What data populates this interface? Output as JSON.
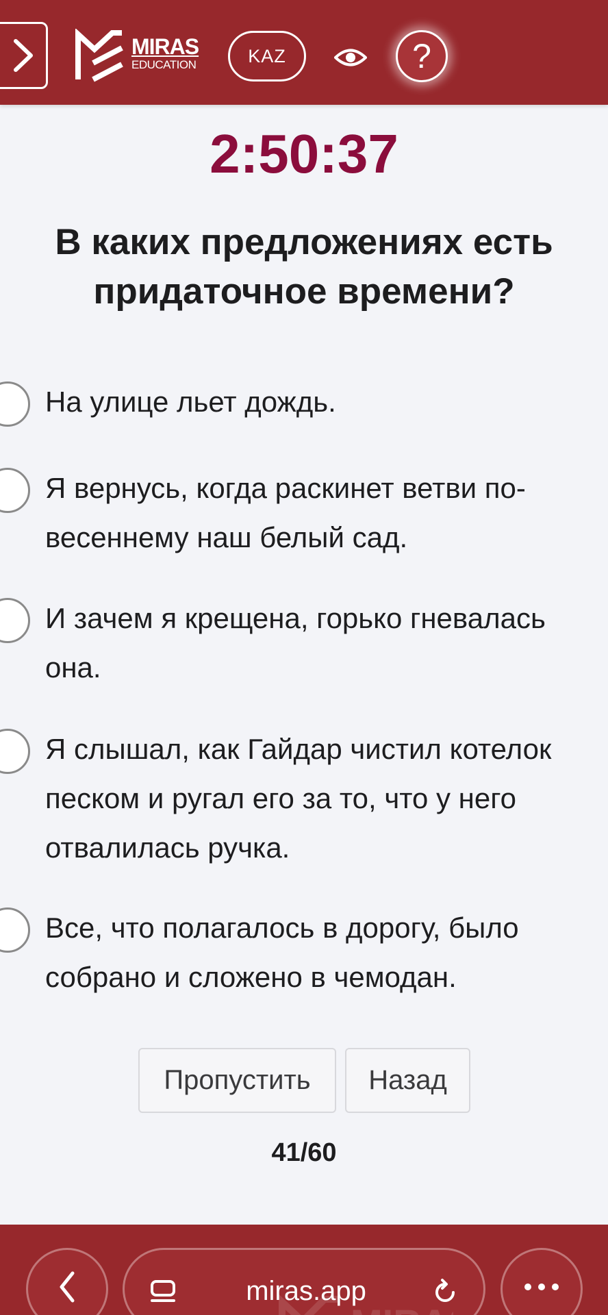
{
  "header": {
    "menu_icon": "chevron-right-icon",
    "logo": {
      "brand": "MIRAS",
      "sub": "EDUCATION"
    },
    "language_label": "KAZ",
    "eye_icon": "eye-icon",
    "help_label": "?",
    "accent_color": "#97282c"
  },
  "timer": {
    "value": "2:50:37",
    "color": "#8b0d3c"
  },
  "question": {
    "lines": [
      "В каких предложениях есть",
      "придаточное времени?"
    ]
  },
  "options": [
    {
      "lines": [
        "На улице льет дождь."
      ],
      "selected": false
    },
    {
      "lines": [
        "Я вернусь, когда раскинет ветви по-",
        "весеннему наш белый сад."
      ],
      "selected": false
    },
    {
      "lines": [
        "И зачем я крещена, горько гневалась",
        "она."
      ],
      "selected": false
    },
    {
      "lines": [
        "Я слышал, как Гайдар чистил котелок",
        "песком и ругал его за то, что у него",
        "отвалилась ручка."
      ],
      "selected": false
    },
    {
      "lines": [
        "Все, что полагалось в дорогу, было",
        "собрано и сложено в чемодан."
      ],
      "selected": false
    }
  ],
  "actions": {
    "skip_label": "Пропустить",
    "back_label": "Назад"
  },
  "progress": {
    "text": "41/60",
    "current": 41,
    "total": 60
  },
  "browser": {
    "url": "miras.app",
    "back_icon": "chevron-left-icon",
    "reader_icon": "reader-icon",
    "reload_icon": "reload-icon",
    "more_icon": "more-icon"
  }
}
